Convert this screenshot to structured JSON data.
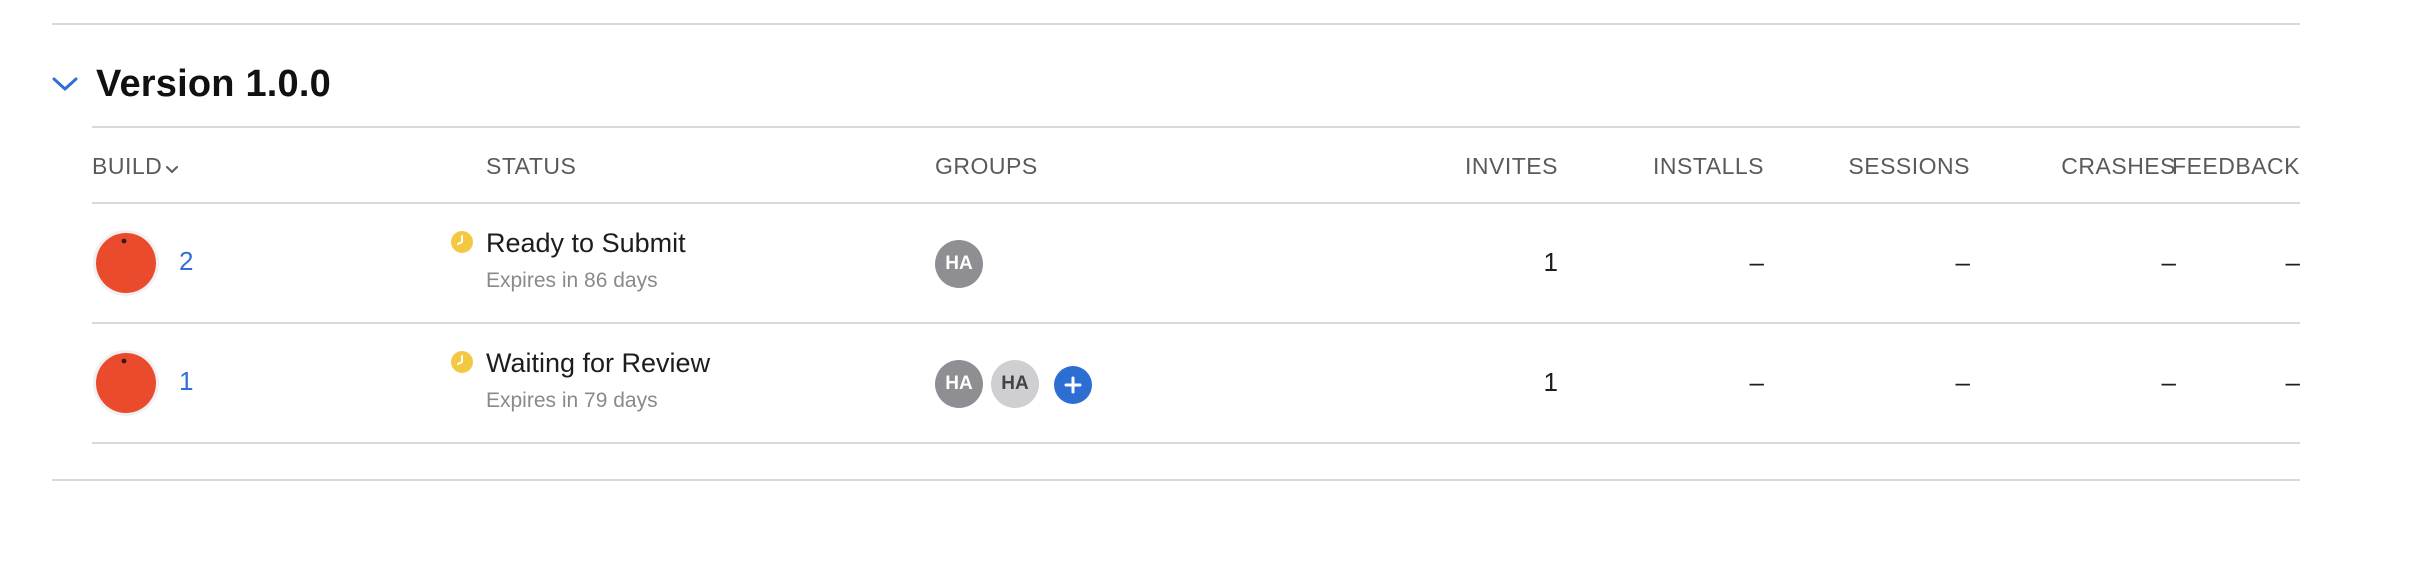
{
  "section": {
    "title": "Version 1.0.0",
    "expanded": true
  },
  "columns": {
    "build": "BUILD",
    "status": "STATUS",
    "groups": "GROUPS",
    "invites": "INVITES",
    "installs": "INSTALLS",
    "sessions": "SESSIONS",
    "crashes": "CRASHES",
    "feedback": "FEEDBACK"
  },
  "builds": [
    {
      "build": "2",
      "status": "Ready to Submit",
      "expires": "Expires in 86 days",
      "groups": [
        {
          "initials": "HA",
          "style": "dark"
        }
      ],
      "has_add": false,
      "invites": "1",
      "installs": "–",
      "sessions": "–",
      "crashes": "–",
      "feedback": "–"
    },
    {
      "build": "1",
      "status": "Waiting for Review",
      "expires": "Expires in 79 days",
      "groups": [
        {
          "initials": "HA",
          "style": "dark"
        },
        {
          "initials": "HA",
          "style": "light"
        }
      ],
      "has_add": true,
      "invites": "1",
      "installs": "–",
      "sessions": "–",
      "crashes": "–",
      "feedback": "–"
    }
  ],
  "colors": {
    "accent": "#2f6fd6",
    "app_icon": "#e94b2c",
    "status_pending": "#f5c842",
    "avatar_dark": "#8e8e93",
    "avatar_light": "#cfcfd2",
    "divider": "#d9d9dc"
  },
  "icons": {
    "collapse": "chevron-down-icon",
    "status": "clock-icon",
    "sort": "chevron-down-icon",
    "add": "plus-icon"
  }
}
